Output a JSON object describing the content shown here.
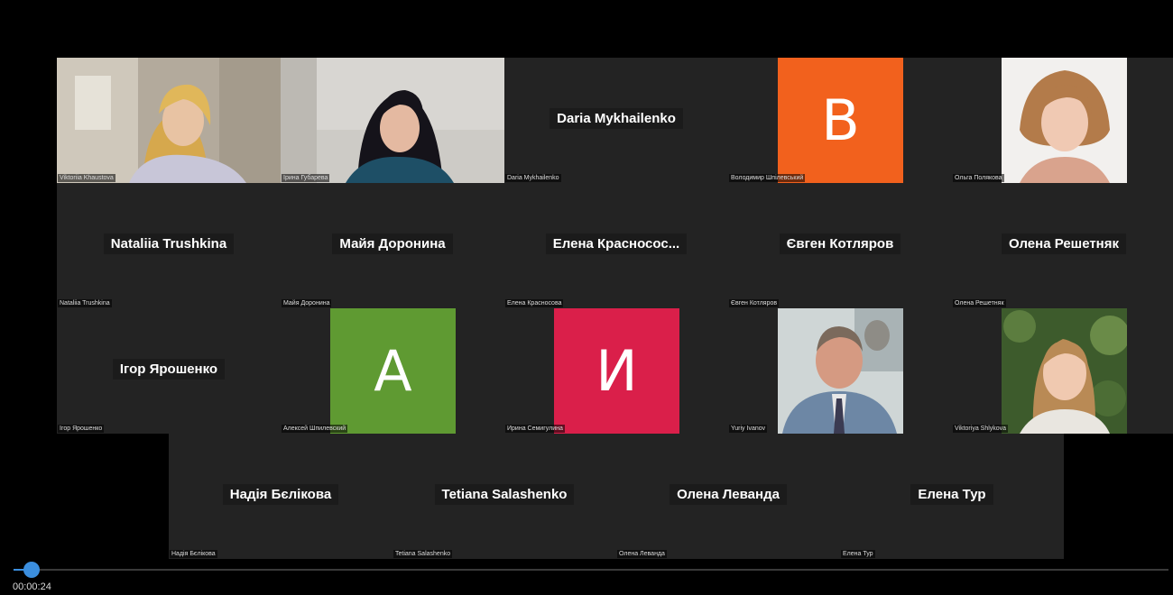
{
  "meeting": {
    "tiles": [
      {
        "type": "video",
        "name": "Viktoriia Khaustova",
        "label": "Viktoriia Khaustova"
      },
      {
        "type": "video",
        "name": "Ірина Губарєва",
        "label": "Ірина Губарева"
      },
      {
        "type": "name",
        "name": "Daria Mykhailenko",
        "label": "Daria Mykhailenko"
      },
      {
        "type": "avatar",
        "initial": "B",
        "color": "#f2611d",
        "label": "Володимир Шпілевський"
      },
      {
        "type": "photo",
        "label": "Ольга Полякова"
      },
      {
        "type": "name",
        "name": "Nataliia Trushkina",
        "label": "Nataliia Trushkina"
      },
      {
        "type": "name",
        "name": "Майя Доронина",
        "label": "Майя Доронина"
      },
      {
        "type": "name",
        "name": "Елена  Красносос...",
        "label": "Елена Красносова"
      },
      {
        "type": "name",
        "name": "Євген Котляров",
        "label": "Євген Котляров"
      },
      {
        "type": "name",
        "name": "Олена Решетняк",
        "label": "Олена Решетняк"
      },
      {
        "type": "name",
        "name": "Ігор Ярошенко",
        "label": "Ігор Ярошенко"
      },
      {
        "type": "avatar",
        "initial": "A",
        "color": "#5f9a32",
        "label": "Алексей Шпилевский"
      },
      {
        "type": "avatar",
        "initial": "И",
        "color": "#da1f4a",
        "label": "Ирина Семигулина"
      },
      {
        "type": "photo",
        "label": "Yuriy Ivanov"
      },
      {
        "type": "photo",
        "label": "Viktoriya Shlykova"
      },
      {
        "type": "name",
        "name": "Надія Бєлікова",
        "label": "Надія Бєлікова"
      },
      {
        "type": "name",
        "name": "Tetiana Salashenko",
        "label": "Tetiana Salashenko"
      },
      {
        "type": "name",
        "name": "Олена Леванда",
        "label": "Олена Леванда"
      },
      {
        "type": "name",
        "name": "Елена Тур",
        "label": "Елена Тур"
      }
    ]
  },
  "player": {
    "time": "00:00:24",
    "progress": 0.016,
    "accent": "#3b8ede"
  }
}
